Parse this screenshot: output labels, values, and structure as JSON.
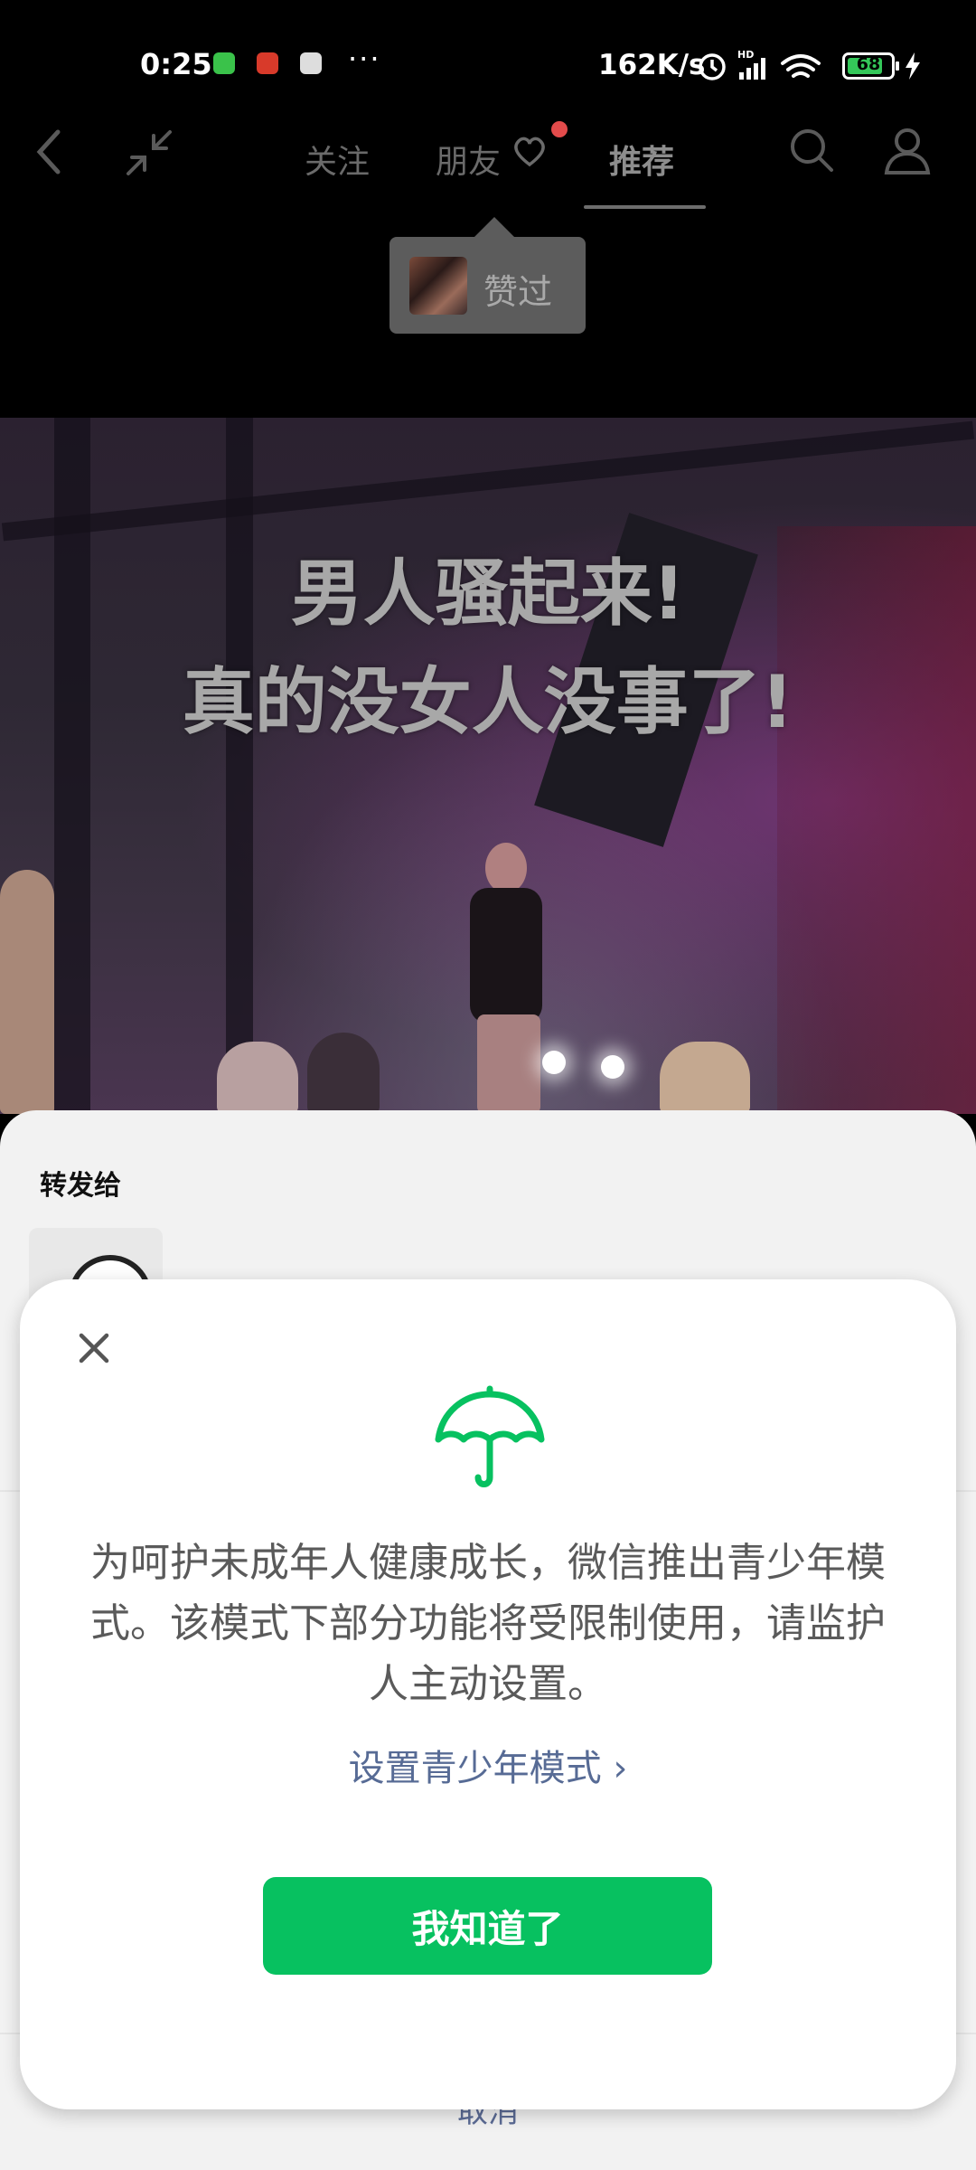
{
  "status_bar": {
    "time": "0:25",
    "dots": "···",
    "speed": "162K/s",
    "battery": "68"
  },
  "top_nav": {
    "tabs": [
      {
        "label": "关注"
      },
      {
        "label": "朋友"
      },
      {
        "label": "推荐"
      }
    ],
    "active_tab": "推荐",
    "liked_popup": "赞过"
  },
  "video": {
    "caption_line1": "男人骚起来!",
    "caption_line2": "真的没女人没事了!"
  },
  "share_sheet": {
    "title": "转发给",
    "cancel": "取消"
  },
  "modal": {
    "body": "为呵护未成年人健康成长，微信推出青少年模式。该模式下部分功能将受限制使用，请监护人主动设置。",
    "link": "设置青少年模式 ›",
    "confirm_button": "我知道了"
  },
  "colors": {
    "accent_green": "#07c160",
    "link_blue": "#576b95",
    "notification_red": "#e34b4b"
  }
}
